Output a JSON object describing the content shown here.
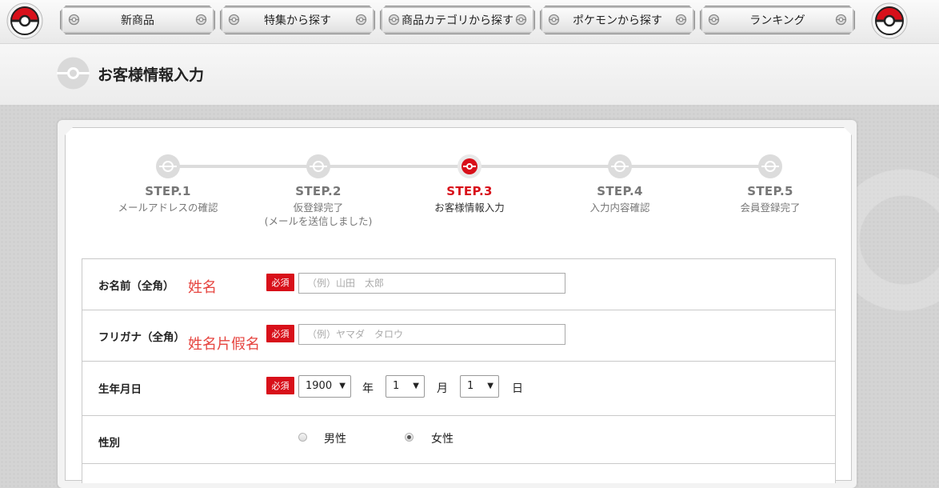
{
  "nav": {
    "items": [
      {
        "label": "新商品"
      },
      {
        "label": "特集から探す"
      },
      {
        "label": "商品カテゴリから探す"
      },
      {
        "label": "ポケモンから探す"
      },
      {
        "label": "ランキング"
      }
    ]
  },
  "page": {
    "title": "お客様情報入力"
  },
  "steps": [
    {
      "num": "STEP.1",
      "label": "メールアドレスの確認",
      "label2": ""
    },
    {
      "num": "STEP.2",
      "label": "仮登録完了",
      "label2": "(メールを送信しました)"
    },
    {
      "num": "STEP.3",
      "label": "お客様情報入力",
      "label2": ""
    },
    {
      "num": "STEP.4",
      "label": "入力内容確認",
      "label2": ""
    },
    {
      "num": "STEP.5",
      "label": "会員登録完了",
      "label2": ""
    }
  ],
  "current_step": 3,
  "form": {
    "required_label": "必須",
    "name": {
      "label": "お名前（全角）",
      "note": "姓名",
      "placeholder": "（例）山田　太郎",
      "value": ""
    },
    "kana": {
      "label": "フリガナ（全角）",
      "note": "姓名片假名",
      "placeholder": "（例）ヤマダ　タロウ",
      "value": ""
    },
    "birthday": {
      "label": "生年月日",
      "year": "1900",
      "year_unit": "年",
      "month": "1",
      "month_unit": "月",
      "day": "1",
      "day_unit": "日"
    },
    "gender": {
      "label": "性別",
      "options": [
        {
          "label": "男性",
          "checked": false
        },
        {
          "label": "女性",
          "checked": true
        }
      ]
    }
  },
  "colors": {
    "accent_red": "#d8101a",
    "note_red": "#e6443f",
    "step_gray": "#dcdcdc"
  },
  "icons": {
    "logo": "pokeball-icon",
    "nav_mini": "pokeball-mini-icon",
    "title": "pokeball-outline-icon"
  }
}
